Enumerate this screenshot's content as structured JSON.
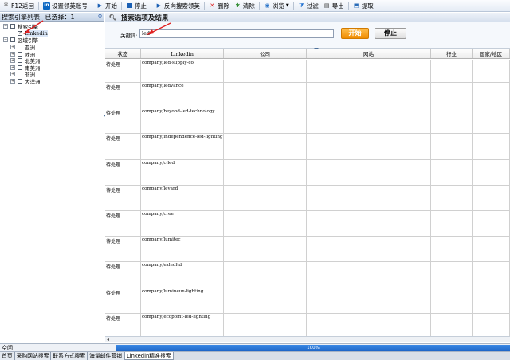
{
  "toolbar": {
    "items": [
      {
        "label": "F12返回",
        "icon": "key-icon"
      },
      {
        "label": "设置领英账号",
        "icon": "linkedin-icon"
      },
      {
        "label": "开始",
        "icon": "play-icon"
      },
      {
        "label": "停止",
        "icon": "stop-icon"
      },
      {
        "label": "反向搜索领英",
        "icon": "play-icon"
      },
      {
        "label": "删除",
        "icon": "delete-icon"
      },
      {
        "label": "清除",
        "icon": "clear-icon"
      },
      {
        "label": "浏览",
        "icon": "globe-icon"
      },
      {
        "label": "过滤",
        "icon": "filter-icon"
      },
      {
        "label": "导出",
        "icon": "export-icon"
      },
      {
        "label": "提取",
        "icon": "extract-icon"
      }
    ]
  },
  "left_panel": {
    "title": "搜索引擎列表",
    "selected_info": "已选择：1",
    "tree": [
      {
        "level": 0,
        "label": "搜索引擎",
        "expander": "-",
        "checked": false
      },
      {
        "level": 1,
        "label": "Linkedin",
        "checked": true,
        "selected": true
      },
      {
        "level": 0,
        "label": "区域引擎",
        "expander": "-",
        "checked": false
      },
      {
        "level": 1,
        "label": "亚洲",
        "expander": "+",
        "checked": false
      },
      {
        "level": 1,
        "label": "欧洲",
        "expander": "+",
        "checked": false
      },
      {
        "level": 1,
        "label": "北美洲",
        "expander": "+",
        "checked": false
      },
      {
        "level": 1,
        "label": "南美洲",
        "expander": "+",
        "checked": false
      },
      {
        "level": 1,
        "label": "非洲",
        "expander": "+",
        "checked": false
      },
      {
        "level": 1,
        "label": "大洋洲",
        "expander": "+",
        "checked": false
      }
    ]
  },
  "search": {
    "title": "搜索选项及结果",
    "keyword_label": "关键词:",
    "keyword_value": "led",
    "start_label": "开始",
    "stop_label": "停止"
  },
  "grid": {
    "columns": [
      "状态",
      "Linkedin",
      "公司",
      "网站",
      "行业",
      "国家/地区"
    ],
    "rows": [
      {
        "status": "待处理",
        "linkedin": "company/led-supply-co"
      },
      {
        "status": "待处理",
        "linkedin": "company/ledvance"
      },
      {
        "status": "待处理",
        "linkedin": "company/beyond-led-technology"
      },
      {
        "status": "待处理",
        "linkedin": "company/independence-led-lighting"
      },
      {
        "status": "待处理",
        "linkedin": "company/c-led"
      },
      {
        "status": "待处理",
        "linkedin": "company/leyard"
      },
      {
        "status": "待处理",
        "linkedin": "company/cree"
      },
      {
        "status": "待处理",
        "linkedin": "company/lumitec"
      },
      {
        "status": "待处理",
        "linkedin": "company/exledltd"
      },
      {
        "status": "待处理",
        "linkedin": "company/lumineux-lighting"
      },
      {
        "status": "待处理",
        "linkedin": "company/ecopoint-led-lighting"
      }
    ]
  },
  "status_bar": {
    "text": "空闲",
    "progress_percent": 100,
    "progress_label": "100%"
  },
  "tabs": [
    {
      "label": "首页",
      "active": false
    },
    {
      "label": "采购网站搜索",
      "active": false
    },
    {
      "label": "联系方式搜索",
      "active": false
    },
    {
      "label": "海量邮件营销",
      "active": false
    },
    {
      "label": "Linkedin精准搜索",
      "active": true
    }
  ],
  "colors": {
    "accent": "#1d66c7",
    "start_button": "#f08c00",
    "annotation_arrow": "#e02020"
  }
}
